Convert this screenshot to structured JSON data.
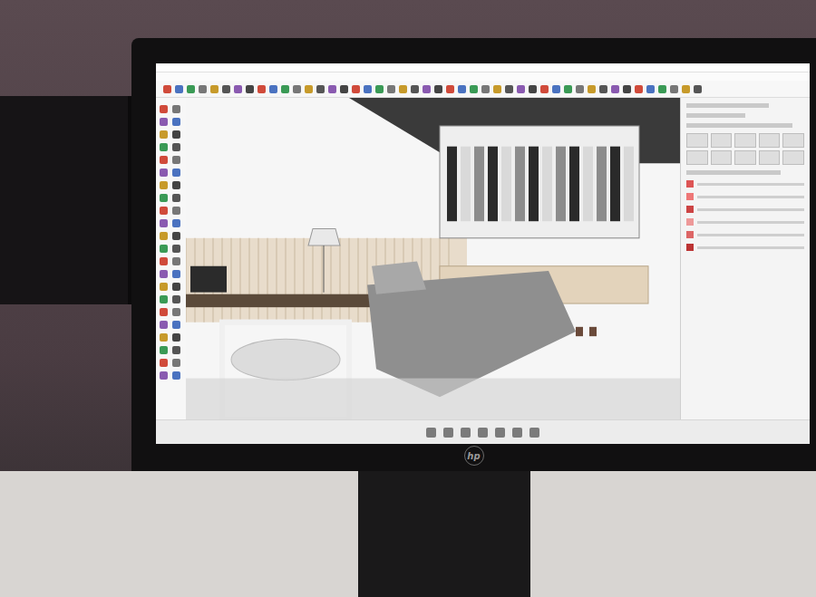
{
  "monitor": {
    "brand": "hp"
  }
}
